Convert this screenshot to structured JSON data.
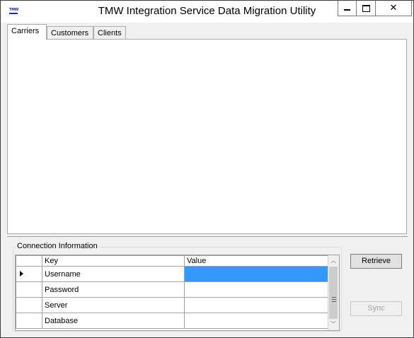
{
  "window": {
    "title": "TMW Integration Service Data Migration Utility",
    "icon_text": "TMW",
    "controls": {
      "minimize_icon": "minimize-icon",
      "maximize_icon": "maximize-icon",
      "close_glyph": "✕"
    }
  },
  "tabs": [
    {
      "label": "Carriers",
      "active": true
    },
    {
      "label": "Customers",
      "active": false
    },
    {
      "label": "Clients",
      "active": false
    }
  ],
  "connection": {
    "group_title": "Connection Information",
    "columns": {
      "key": "Key",
      "value": "Value"
    },
    "rows": [
      {
        "key": "Username",
        "value": "",
        "current": true,
        "value_selected": true
      },
      {
        "key": "Password",
        "value": ""
      },
      {
        "key": "Server",
        "value": ""
      },
      {
        "key": "Database",
        "value": ""
      }
    ]
  },
  "buttons": {
    "retrieve": "Retrieve",
    "sync": "Sync",
    "sync_enabled": false
  },
  "colors": {
    "selection": "#3399ff",
    "window_bg": "#f0f0f0",
    "disabled_text": "#a0a0a0"
  }
}
